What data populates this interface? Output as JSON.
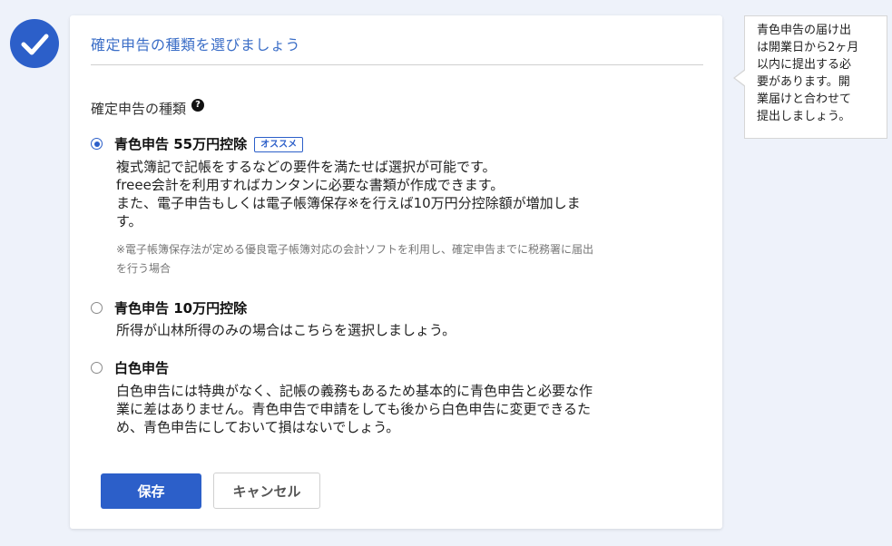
{
  "step": {
    "icon": "check-icon",
    "accent": "#2c5fc9"
  },
  "card": {
    "title": "確定申告の種類を選びましょう",
    "section_label": "確定申告の種類",
    "help_icon": "?",
    "options": [
      {
        "title": "青色申告 55万円控除",
        "badge": "オススメ",
        "selected": true,
        "desc": [
          "複式簿記で記帳をするなどの要件を満たせば選択が可能です。",
          "freee会計を利用すればカンタンに必要な書類が作成できます。",
          "また、電子申告もしくは電子帳簿保存※を行えば10万円分控除額が増加しま",
          "す。"
        ],
        "note": [
          "※電子帳簿保存法が定める優良電子帳簿対応の会計ソフトを利用し、確定申告までに税務署に届出",
          "を行う場合"
        ]
      },
      {
        "title": "青色申告 10万円控除",
        "selected": false,
        "desc": [
          "所得が山林所得のみの場合はこちらを選択しましょう。"
        ]
      },
      {
        "title": "白色申告",
        "selected": false,
        "desc": [
          "白色申告には特典がなく、記帳の義務もあるため基本的に青色申告と必要な作",
          "業に差はありません。青色申告で申請をしても後から白色申告に変更できるた",
          "め、青色申告にしておいて損はないでしょう。"
        ]
      }
    ],
    "save_label": "保存",
    "cancel_label": "キャンセル"
  },
  "tooltip": {
    "lines": [
      "青色申告の届け出",
      "は開業日から2ヶ月",
      "以内に提出する必",
      "要があります。開",
      "業届けと合わせて",
      "提出しましょう。"
    ]
  }
}
